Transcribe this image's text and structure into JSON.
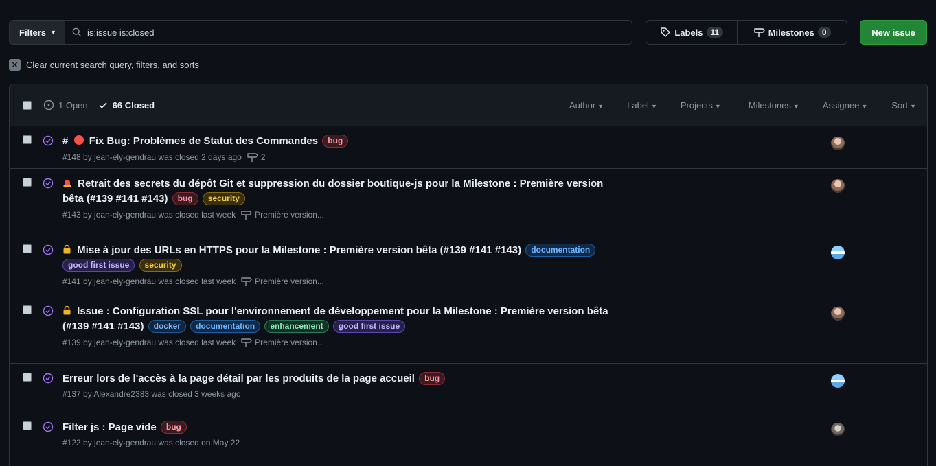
{
  "topbar": {
    "filters_label": "Filters",
    "search_value": "is:issue is:closed",
    "labels_label": "Labels",
    "labels_count": "11",
    "milestones_label": "Milestones",
    "milestones_count": "0",
    "new_issue_label": "New issue"
  },
  "clear": {
    "label": "Clear current search query, filters, and sorts"
  },
  "header": {
    "open_label": "1 Open",
    "closed_label": "66 Closed",
    "filters": [
      "Author",
      "Label",
      "Projects",
      "Milestones",
      "Assignee",
      "Sort"
    ]
  },
  "issues": [
    {
      "title_prefix": "#",
      "title": "Fix Bug: Problèmes de Statut des Commandes",
      "labels": [
        "bug"
      ],
      "meta": "#148 by jean-ely-gendrau was closed 2 days ago",
      "milestone": "2"
    },
    {
      "title": "Retrait des secrets du dépôt Git et suppression du dossier boutique-js pour la Milestone : Première version",
      "title_cont": "bêta (#139 #141 #143)",
      "labels": [
        "bug",
        "security"
      ],
      "meta": "#143 by jean-ely-gendrau was closed last week",
      "milestone": "Première version..."
    },
    {
      "title": "Mise à jour des URLs en HTTPS pour la Milestone : Première version bêta (#139 #141 #143)",
      "labels": [
        "documentation",
        "good first issue",
        "security"
      ],
      "meta": "#141 by jean-ely-gendrau was closed last week",
      "milestone": "Première version..."
    },
    {
      "title": "Issue : Configuration SSL pour l'environnement de développement pour la Milestone : Première version bêta",
      "title_cont": "(#139 #141 #143)",
      "labels": [
        "docker",
        "documentation",
        "enhancement",
        "good first issue"
      ],
      "meta": "#139 by jean-ely-gendrau was closed last week",
      "milestone": "Première version..."
    },
    {
      "title": "Erreur lors de l'accès à la page détail par les produits de la page accueil",
      "labels": [
        "bug"
      ],
      "meta": "#137 by Alexandre2383 was closed 3 weeks ago"
    },
    {
      "title": "Filter js : Page vide",
      "labels": [
        "bug"
      ],
      "meta": "#122 by jean-ely-gendrau was closed on May 22"
    }
  ],
  "colors": {
    "background": "#0d1117",
    "accent_green": "#238636",
    "closed_purple": "#a371f7"
  }
}
